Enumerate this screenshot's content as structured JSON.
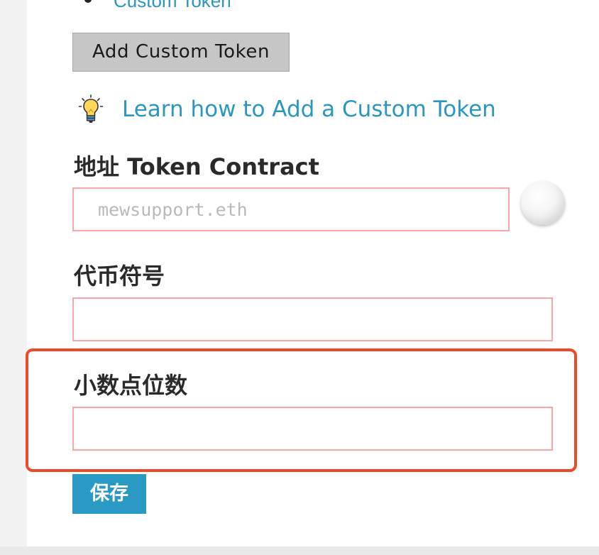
{
  "token_list": {
    "top_link_label": "Custom Token"
  },
  "add_custom_token_button": {
    "label": "Add Custom Token"
  },
  "learn_link": {
    "icon": "lightbulb-icon",
    "label": "Learn how to Add a Custom Token"
  },
  "form": {
    "address": {
      "label": "地址 Token Contract",
      "placeholder": "mewsupport.eth",
      "value": ""
    },
    "symbol": {
      "label": "代币符号",
      "value": ""
    },
    "decimals": {
      "label": "小数点位数",
      "value": ""
    },
    "save_button": {
      "label": "保存"
    }
  },
  "colors": {
    "link": "#2b96bf",
    "save_button": "#2a9ac5",
    "field_border": "#f2aaa8",
    "highlight": "#ee4a2a",
    "add_button_bg": "#c6c6c6"
  }
}
